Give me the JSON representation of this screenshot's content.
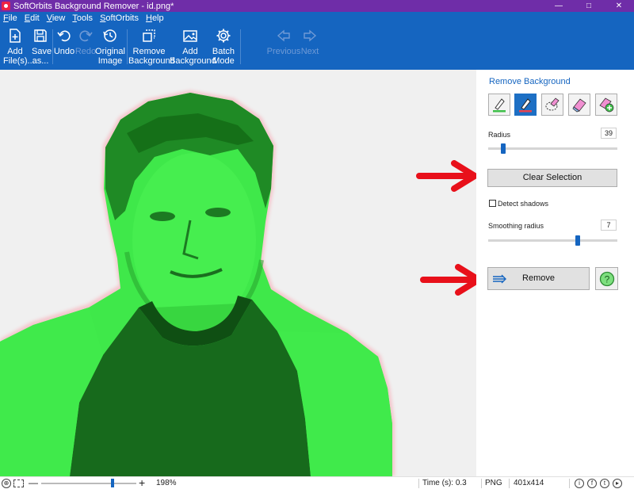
{
  "window": {
    "title": "SoftOrbits Background Remover - id.png*",
    "controls": {
      "minimize": "—",
      "maximize": "□",
      "close": "✕"
    }
  },
  "menu": [
    "File",
    "Edit",
    "View",
    "Tools",
    "SoftOrbits",
    "Help"
  ],
  "toolbar": {
    "add_files": "Add File(s)...",
    "save_as": "Save as...",
    "undo": "Undo",
    "redo": "Redo",
    "original_image": "Original Image",
    "remove_background": "Remove Background",
    "add_background": "Add Background",
    "batch_mode": "Batch Mode",
    "previous": "Previous",
    "next": "Next"
  },
  "panel": {
    "title": "Remove Background",
    "tools": [
      "keep-marker-icon",
      "remove-marker-icon",
      "lasso-eraser-icon",
      "eraser-icon",
      "magic-eraser-icon"
    ],
    "radius_label": "Radius",
    "radius_value": "39",
    "radius_fraction": 0.1,
    "clear_selection": "Clear Selection",
    "detect_shadows": "Detect shadows",
    "detect_shadows_checked": false,
    "smoothing_label": "Smoothing radius",
    "smoothing_value": "7",
    "smoothing_fraction": 0.7,
    "remove": "Remove",
    "help_icon": "?"
  },
  "colors": {
    "title_bar": "#6f2da8",
    "toolbar": "#1565c0",
    "highlight": "#3fe84a",
    "arrow": "#e8101a"
  },
  "status": {
    "zoom": "198%",
    "time": "Time (s): 0.3",
    "format": "PNG",
    "dimensions": "401x414"
  }
}
